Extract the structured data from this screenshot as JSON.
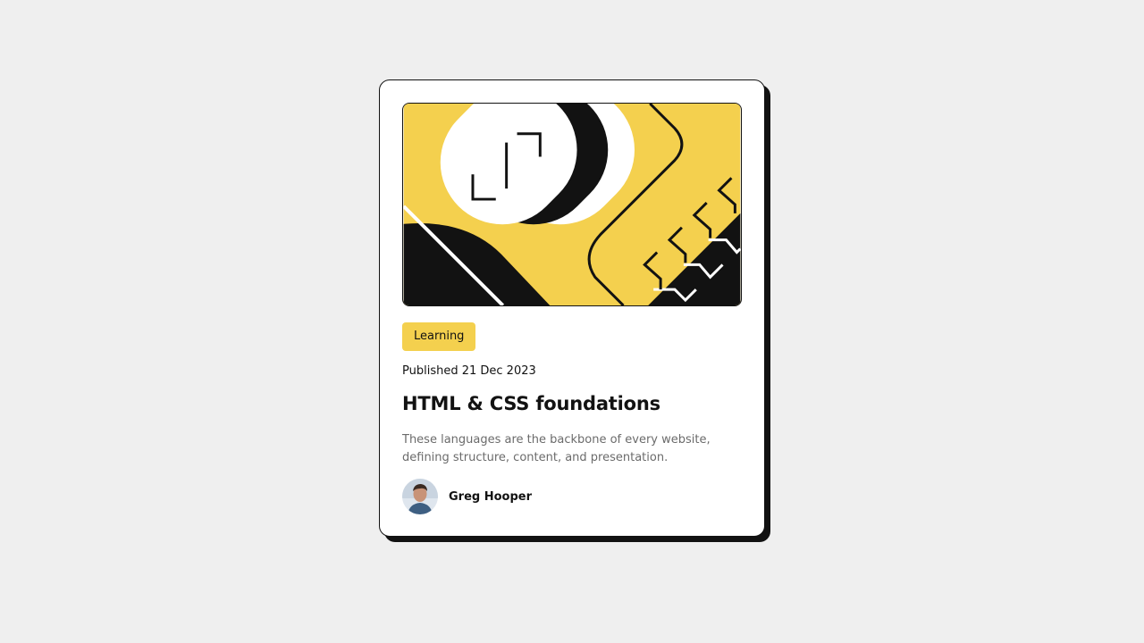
{
  "card": {
    "category": "Learning",
    "published": "Published 21 Dec 2023",
    "title": "HTML & CSS foundations",
    "description": "These languages are the backbone of every website, defining structure, content, and presentation.",
    "author": {
      "name": "Greg Hooper",
      "avatar": "avatar-photo"
    },
    "illustration": "abstract-yellow-illustration"
  },
  "colors": {
    "background": "#efefef",
    "card": "#ffffff",
    "accent_yellow": "#f4d04e",
    "ink": "#121212",
    "muted_text": "#6b6b6b"
  }
}
